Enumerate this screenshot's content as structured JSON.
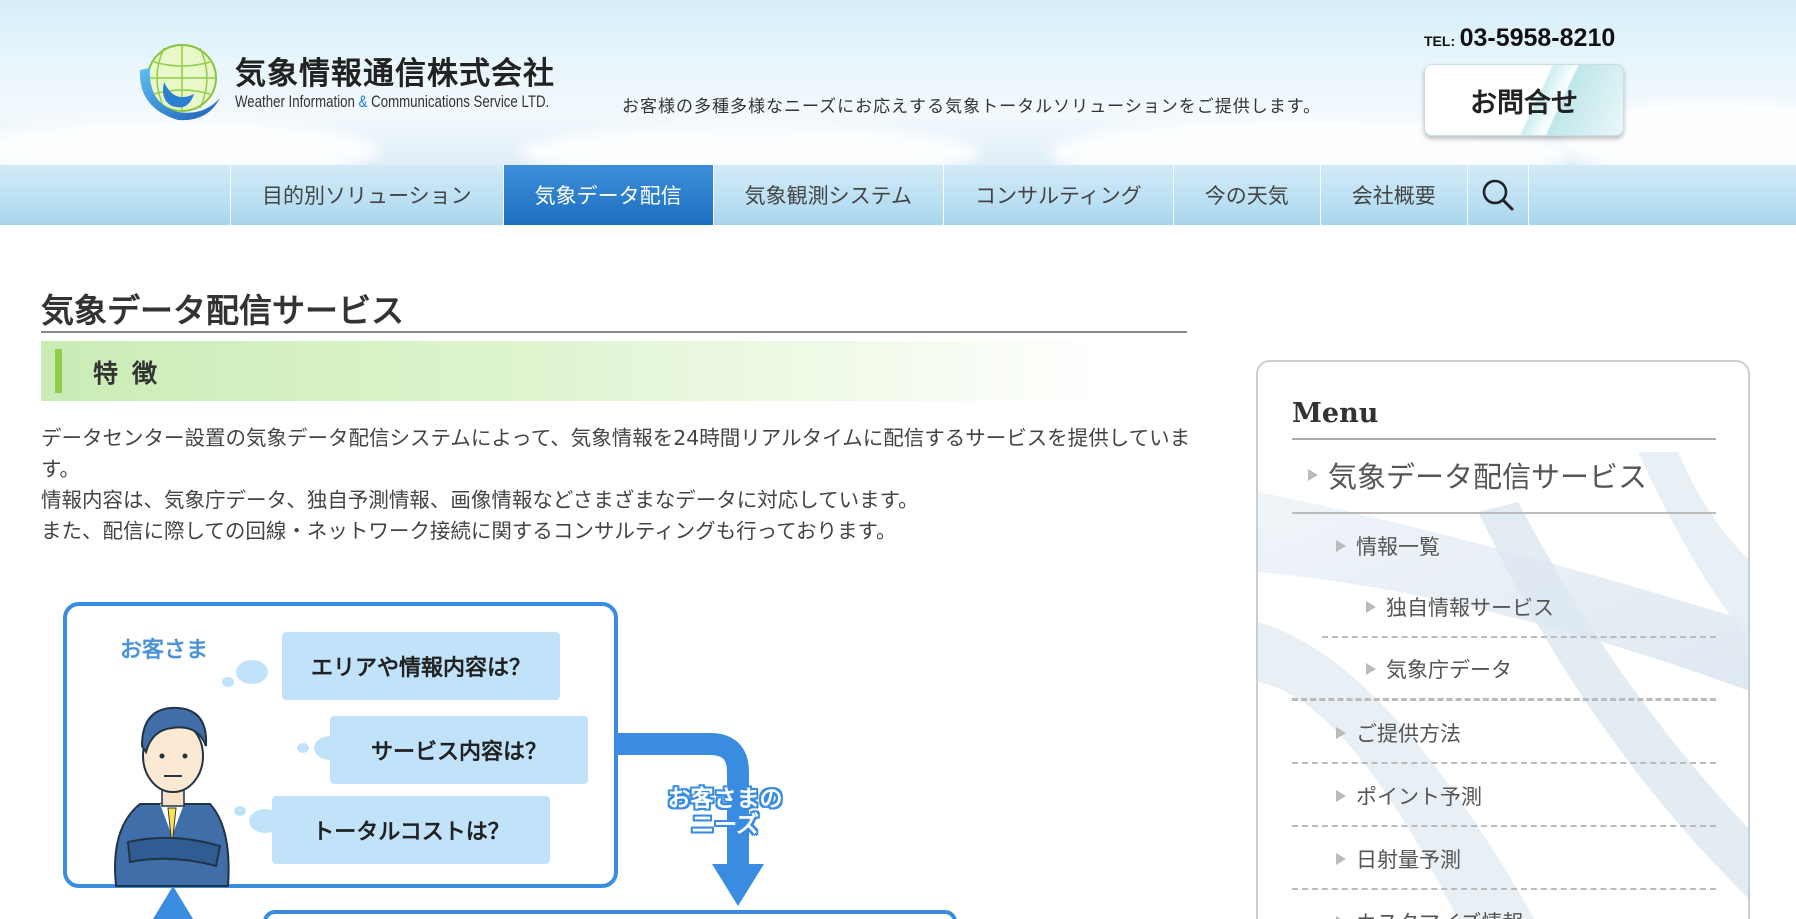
{
  "header": {
    "company_name": "気象情報通信株式会社",
    "company_name_en_pre": "Weather Information ",
    "company_name_en_amp": "&",
    "company_name_en_post": " Communications Service LTD.",
    "tagline": "お客様の多種多様なニーズにお応えする気象トータルソリューションをご提供します。",
    "tel_label": "TEL:",
    "tel_number": "03-5958-8210",
    "contact_label": "お問合せ"
  },
  "nav": {
    "items": [
      {
        "label": "目的別ソリューション"
      },
      {
        "label": "気象データ配信"
      },
      {
        "label": "気象観測システム"
      },
      {
        "label": "コンサルティング"
      },
      {
        "label": "今の天気"
      },
      {
        "label": "会社概要"
      }
    ],
    "active_index": 1
  },
  "main": {
    "page_title": "気象データ配信サービス",
    "section_heading": "特徴",
    "paragraphs": [
      "データセンター設置の気象データ配信システムによって、気象情報を24時間リアルタイムに配信するサービスを提供しています。",
      "情報内容は、気象庁データ、独自予測情報、画像情報などさまざまなデータに対応しています。",
      "また、配信に際しての回線・ネットワーク接続に関するコンサルティングも行っております。"
    ]
  },
  "diagram": {
    "customer_label": "お客さま",
    "questions": [
      "エリアや情報内容は？",
      "サービス内容は？",
      "トータルコストは？"
    ],
    "needs_label_line1": "お客さまの",
    "needs_label_line2": "ニーズ"
  },
  "sidebar": {
    "menu_title": "Menu",
    "items": [
      {
        "label": "気象データ配信サービス"
      },
      {
        "label": "情報一覧"
      },
      {
        "label": "独自情報サービス"
      },
      {
        "label": "気象庁データ"
      },
      {
        "label": "ご提供方法"
      },
      {
        "label": "ポイント予測"
      },
      {
        "label": "日射量予測"
      },
      {
        "label": "カスタマイズ情報"
      }
    ]
  },
  "colors": {
    "nav_active": "#1d6fc0",
    "section_accent": "#8fcc4c",
    "diagram_blue": "#3a8ce0",
    "bubble_fill": "#c0e3fa"
  }
}
